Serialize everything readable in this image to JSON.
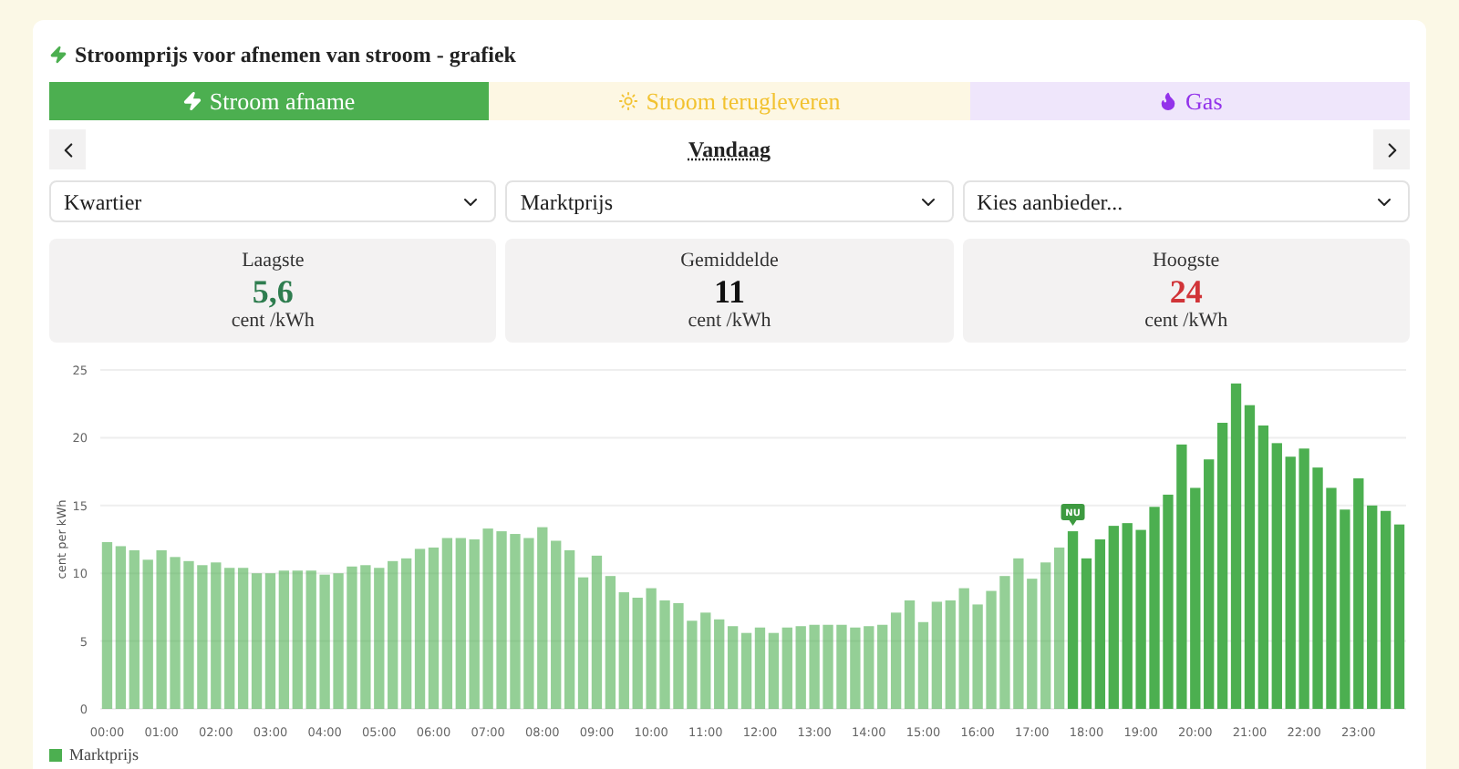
{
  "card_title": "Stroomprijs voor afnemen van stroom - grafiek",
  "tabs": [
    {
      "kind": "electricity",
      "label": "Stroom afname",
      "selected": true
    },
    {
      "kind": "solar",
      "label": "Stroom terugleveren",
      "selected": false
    },
    {
      "kind": "gas",
      "label": "Gas",
      "selected": false
    }
  ],
  "date_nav": {
    "label": "Vandaag"
  },
  "selects": [
    {
      "value": "Kwartier"
    },
    {
      "value": "Marktprijs"
    },
    {
      "value": "Kies aanbieder..."
    }
  ],
  "stats": [
    {
      "kind": "low",
      "label": "Laagste",
      "value": "5,6",
      "unit": "cent /kWh"
    },
    {
      "kind": "avg",
      "label": "Gemiddelde",
      "value": "11",
      "unit": "cent /kWh"
    },
    {
      "kind": "high",
      "label": "Hoogste",
      "value": "24",
      "unit": "cent /kWh"
    }
  ],
  "chart_data": {
    "type": "bar",
    "grid": true,
    "ylabel": "cent per kWh",
    "xlim": [
      -0.125,
      23.875
    ],
    "ylim": [
      0,
      25
    ],
    "yticks": [
      0,
      5,
      10,
      15,
      20,
      25
    ],
    "x": [
      0,
      0.25,
      0.5,
      0.75,
      1,
      1.25,
      1.5,
      1.75,
      2,
      2.25,
      2.5,
      2.75,
      3,
      3.25,
      3.5,
      3.75,
      4,
      4.25,
      4.5,
      4.75,
      5,
      5.25,
      5.5,
      5.75,
      6,
      6.25,
      6.5,
      6.75,
      7,
      7.25,
      7.5,
      7.75,
      8,
      8.25,
      8.5,
      8.75,
      9,
      9.25,
      9.5,
      9.75,
      10,
      10.25,
      10.5,
      10.75,
      11,
      11.25,
      11.5,
      11.75,
      12,
      12.25,
      12.5,
      12.75,
      13,
      13.25,
      13.5,
      13.75,
      14,
      14.25,
      14.5,
      14.75,
      15,
      15.25,
      15.5,
      15.75,
      16,
      16.25,
      16.5,
      16.75,
      17,
      17.25,
      17.5,
      17.75,
      18,
      18.25,
      18.5,
      18.75,
      19,
      19.25,
      19.5,
      19.75,
      20,
      20.25,
      20.5,
      20.75,
      21,
      21.25,
      21.5,
      21.75,
      22,
      22.25,
      22.5,
      22.75,
      23,
      23.25,
      23.5,
      23.75
    ],
    "xticks": [
      {
        "value": 0,
        "label": "00:00"
      },
      {
        "value": 1,
        "label": "01:00"
      },
      {
        "value": 2,
        "label": "02:00"
      },
      {
        "value": 3,
        "label": "03:00"
      },
      {
        "value": 4,
        "label": "04:00"
      },
      {
        "value": 5,
        "label": "05:00"
      },
      {
        "value": 6,
        "label": "06:00"
      },
      {
        "value": 7,
        "label": "07:00"
      },
      {
        "value": 8,
        "label": "08:00"
      },
      {
        "value": 9,
        "label": "09:00"
      },
      {
        "value": 10,
        "label": "10:00"
      },
      {
        "value": 11,
        "label": "11:00"
      },
      {
        "value": 12,
        "label": "12:00"
      },
      {
        "value": 13,
        "label": "13:00"
      },
      {
        "value": 14,
        "label": "14:00"
      },
      {
        "value": 15,
        "label": "15:00"
      },
      {
        "value": 16,
        "label": "16:00"
      },
      {
        "value": 17,
        "label": "17:00"
      },
      {
        "value": 18,
        "label": "18:00"
      },
      {
        "value": 19,
        "label": "19:00"
      },
      {
        "value": 20,
        "label": "20:00"
      },
      {
        "value": 21,
        "label": "21:00"
      },
      {
        "value": 22,
        "label": "22:00"
      },
      {
        "value": 23,
        "label": "23:00"
      }
    ],
    "series": [
      {
        "name": "Marktprijs",
        "color": "#4caf50",
        "values": [
          12.3,
          12.0,
          11.7,
          11.0,
          11.7,
          11.2,
          10.9,
          10.6,
          10.8,
          10.4,
          10.4,
          10.0,
          10.0,
          10.2,
          10.2,
          10.2,
          9.9,
          10.0,
          10.5,
          10.6,
          10.4,
          10.9,
          11.1,
          11.8,
          11.9,
          12.6,
          12.6,
          12.5,
          13.3,
          13.1,
          12.9,
          12.6,
          13.4,
          12.4,
          11.7,
          9.7,
          11.3,
          9.8,
          8.6,
          8.2,
          8.9,
          8.0,
          7.8,
          6.5,
          7.1,
          6.6,
          6.1,
          5.6,
          6.0,
          5.6,
          6.0,
          6.1,
          6.2,
          6.2,
          6.2,
          6.0,
          6.1,
          6.2,
          7.1,
          8.0,
          6.4,
          7.9,
          8.0,
          8.9,
          7.7,
          8.7,
          9.8,
          11.1,
          9.6,
          10.8,
          11.9,
          13.1,
          11.1,
          12.5,
          13.5,
          13.7,
          13.2,
          14.9,
          15.8,
          19.5,
          16.3,
          18.4,
          21.1,
          24.0,
          22.4,
          20.9,
          19.6,
          18.6,
          19.2,
          17.8,
          16.3,
          14.7,
          17.0,
          15.0,
          14.6,
          13.6
        ]
      }
    ],
    "annotations": [
      {
        "x": 17.75,
        "text": "NU"
      }
    ]
  }
}
